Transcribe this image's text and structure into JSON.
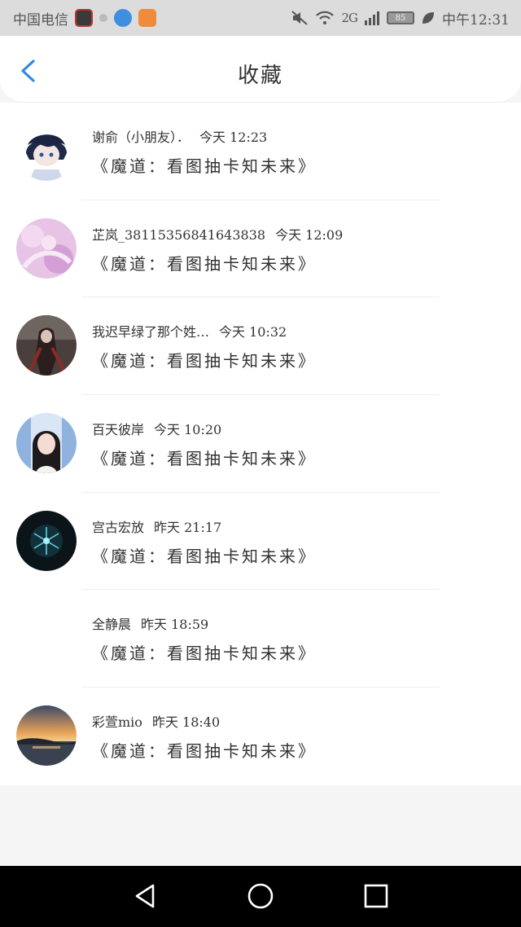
{
  "status_bar": {
    "carrier": "中国电信",
    "battery": "85",
    "network": "2G",
    "time": "中午12:31"
  },
  "header": {
    "title": "收藏",
    "back_icon": "chevron-left-icon",
    "accent_color": "#2f8ae5"
  },
  "favorites": [
    {
      "user": "谢俞（小朋友）．",
      "time": "今天 12:23",
      "book": "《魔道：看图抽卡知未来》",
      "avatar": "anime-boy-avatar"
    },
    {
      "user": "芷岚_38115356841643838",
      "time": "今天 12:09",
      "book": "《魔道：看图抽卡知未来》",
      "avatar": "pink-anime-avatar"
    },
    {
      "user": "我迟早绿了那个姓…",
      "time": "今天 10:32",
      "book": "《魔道：看图抽卡知未来》",
      "avatar": "dark-art-avatar"
    },
    {
      "user": "百天彼岸",
      "time": "今天 10:20",
      "book": "《魔道：看图抽卡知未来》",
      "avatar": "girl-photo-avatar"
    },
    {
      "user": "宫古宏放",
      "time": "昨天 21:17",
      "book": "《魔道：看图抽卡知未来》",
      "avatar": "snowflake-avatar"
    },
    {
      "user": "全静晨",
      "time": "昨天 18:59",
      "book": "《魔道：看图抽卡知未来》",
      "avatar": ""
    },
    {
      "user": "彩萱mio",
      "time": "昨天 18:40",
      "book": "《魔道：看图抽卡知未来》",
      "avatar": "sunset-lake-avatar"
    }
  ],
  "nav": {
    "back": "triangle-back-icon",
    "home": "circle-home-icon",
    "recent": "square-recent-icon"
  }
}
